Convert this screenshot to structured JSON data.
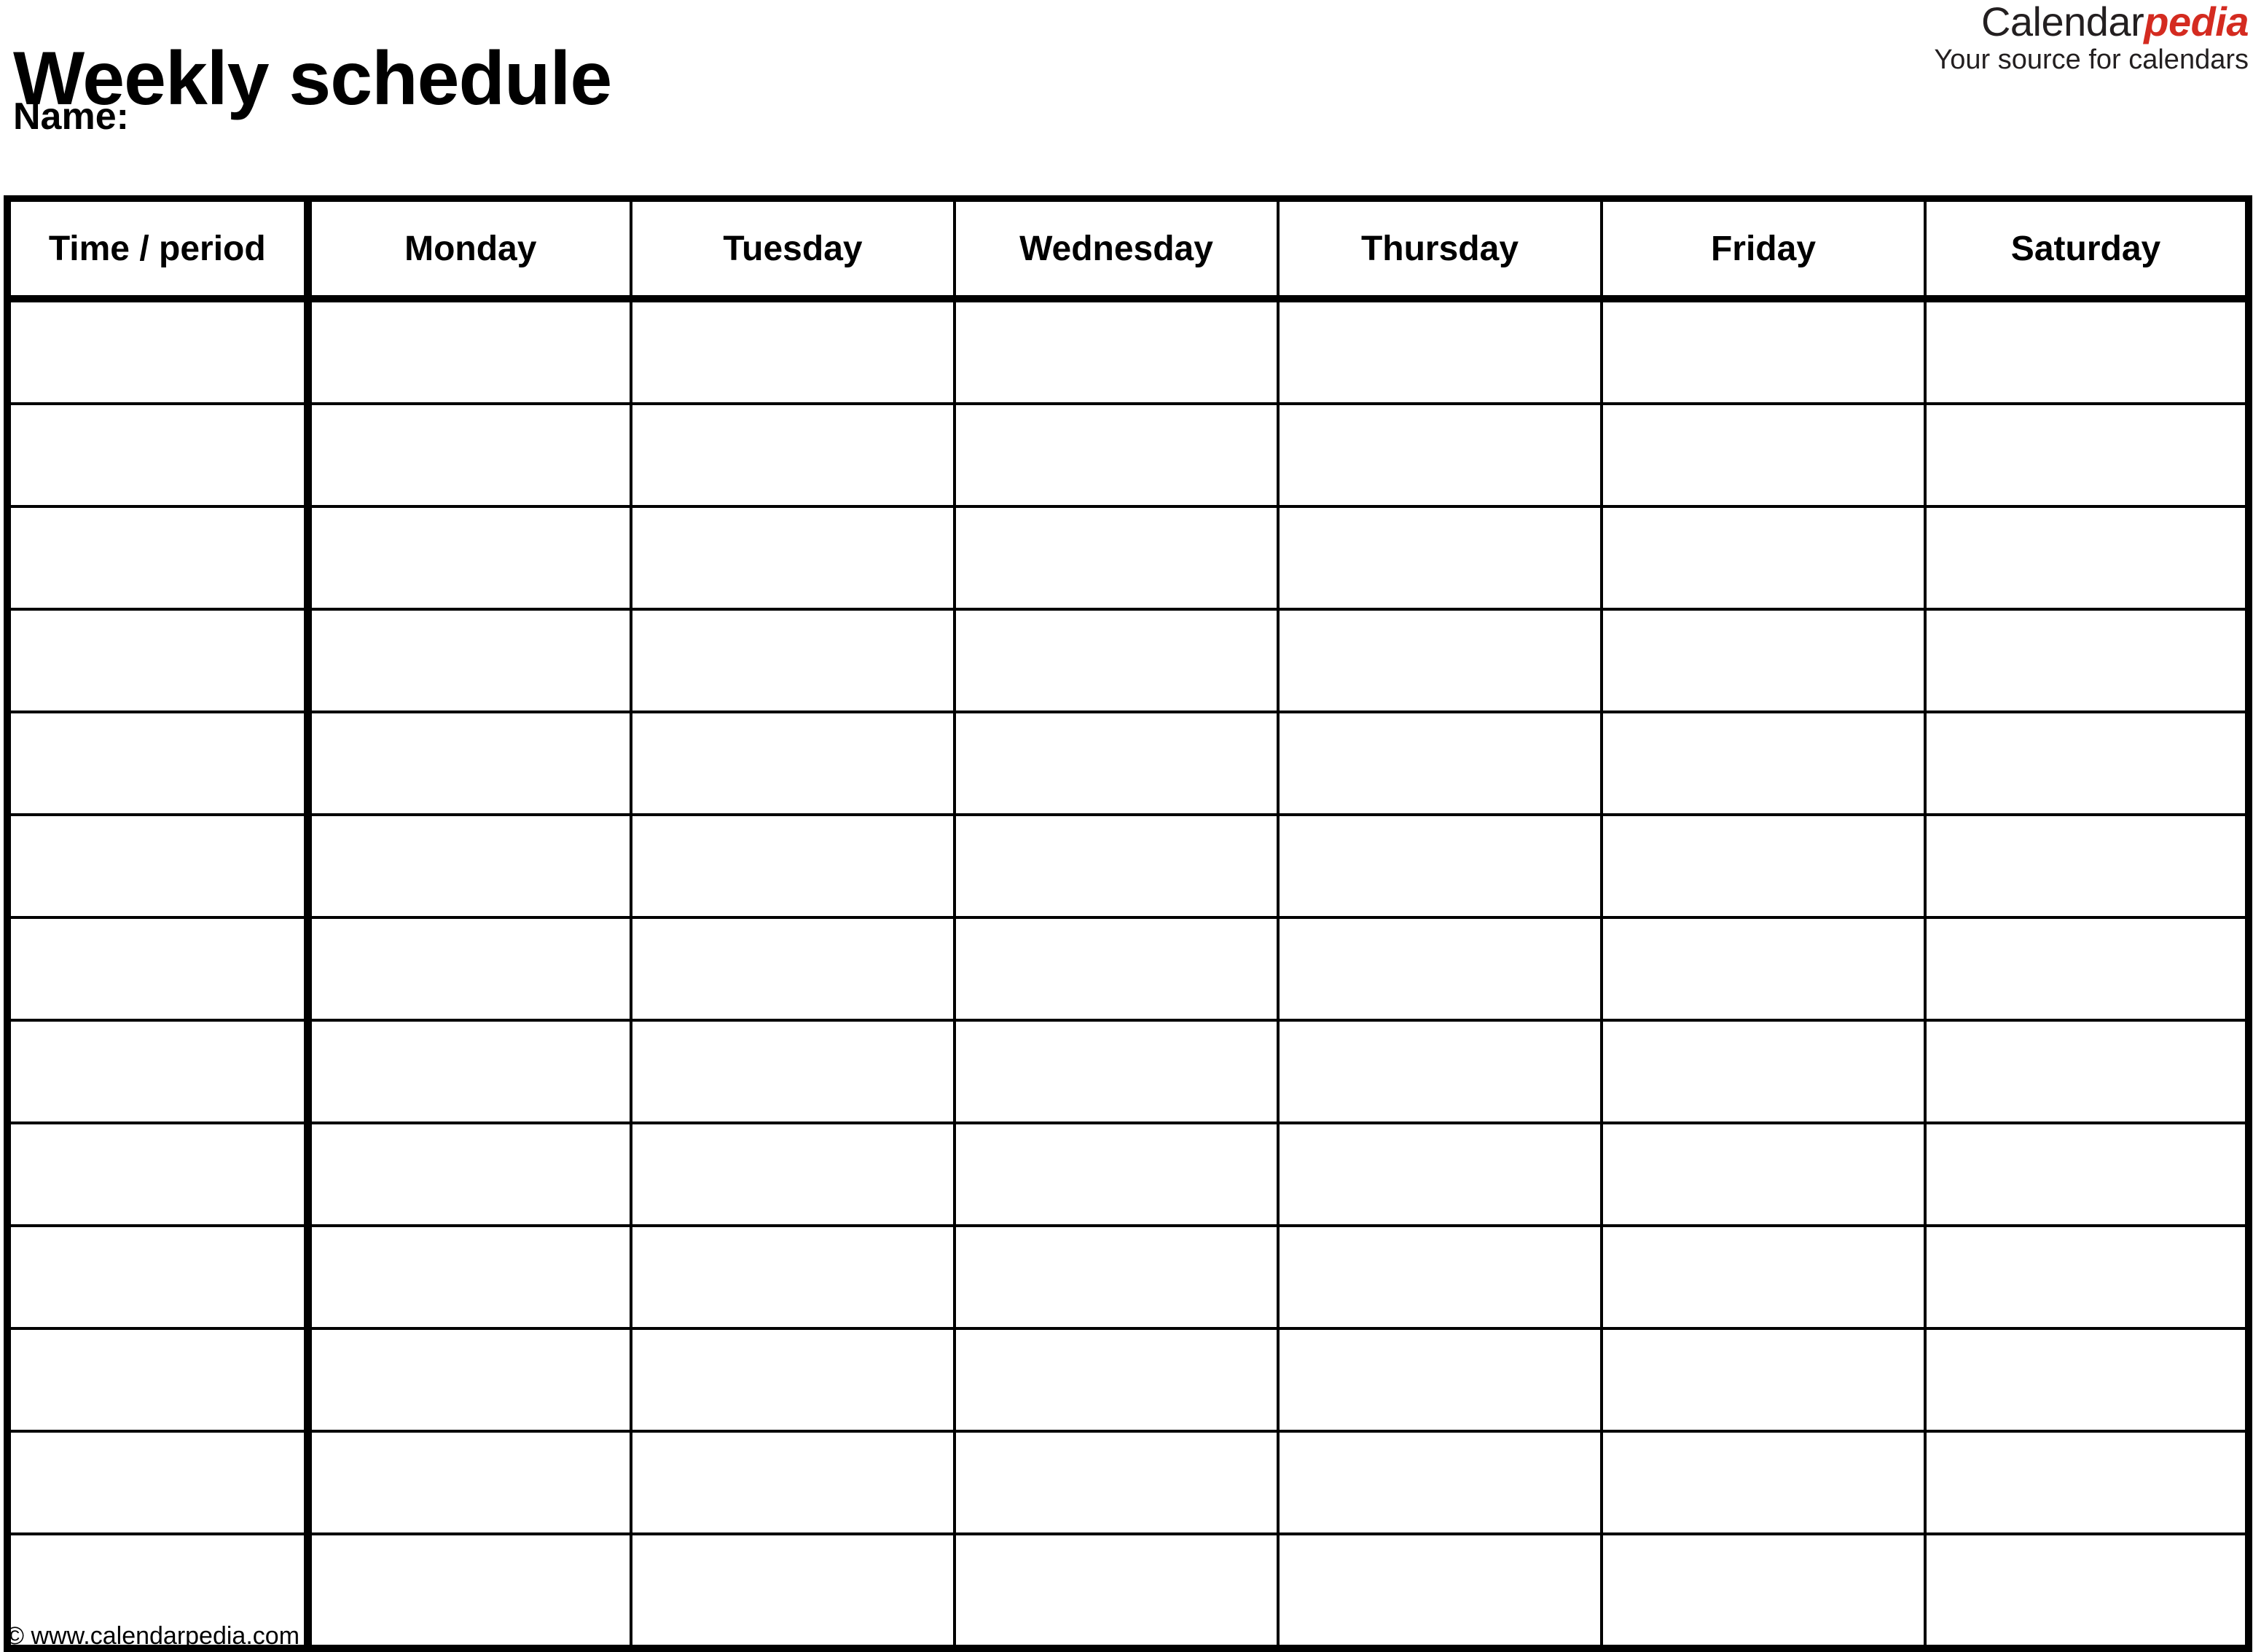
{
  "document": {
    "title": "Weekly schedule",
    "name_label": "Name:"
  },
  "brand": {
    "part_1": "Calendar",
    "part_2": "pedia",
    "tagline": "Your source for calendars",
    "accent_color": "#d42b20",
    "text_color": "#231f20"
  },
  "table": {
    "headers": [
      "Time / period",
      "Monday",
      "Tuesday",
      "Wednesday",
      "Thursday",
      "Friday",
      "Saturday"
    ],
    "row_count": 13,
    "column_count": 7,
    "rows": [
      {
        "cells": [
          "",
          "",
          "",
          "",
          "",
          "",
          ""
        ]
      },
      {
        "cells": [
          "",
          "",
          "",
          "",
          "",
          "",
          ""
        ]
      },
      {
        "cells": [
          "",
          "",
          "",
          "",
          "",
          "",
          ""
        ]
      },
      {
        "cells": [
          "",
          "",
          "",
          "",
          "",
          "",
          ""
        ]
      },
      {
        "cells": [
          "",
          "",
          "",
          "",
          "",
          "",
          ""
        ]
      },
      {
        "cells": [
          "",
          "",
          "",
          "",
          "",
          "",
          ""
        ]
      },
      {
        "cells": [
          "",
          "",
          "",
          "",
          "",
          "",
          ""
        ]
      },
      {
        "cells": [
          "",
          "",
          "",
          "",
          "",
          "",
          ""
        ]
      },
      {
        "cells": [
          "",
          "",
          "",
          "",
          "",
          "",
          ""
        ]
      },
      {
        "cells": [
          "",
          "",
          "",
          "",
          "",
          "",
          ""
        ]
      },
      {
        "cells": [
          "",
          "",
          "",
          "",
          "",
          "",
          ""
        ]
      },
      {
        "cells": [
          "",
          "",
          "",
          "",
          "",
          "",
          ""
        ]
      },
      {
        "cells": [
          "",
          "",
          "",
          "",
          "",
          "",
          ""
        ]
      }
    ]
  },
  "footer": {
    "copyright": "© www.calendarpedia.com"
  }
}
